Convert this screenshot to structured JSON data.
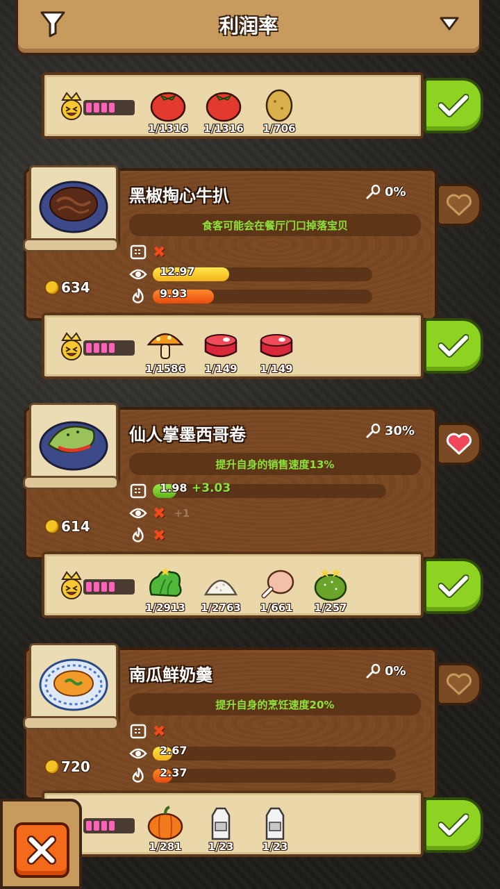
{
  "header": {
    "title": "利润率"
  },
  "top_strip": {
    "ingredients": [
      {
        "name": "tomato",
        "count": "1/1316"
      },
      {
        "name": "tomato",
        "count": "1/1316"
      },
      {
        "name": "potato",
        "count": "1/706"
      }
    ]
  },
  "dishes": [
    {
      "name": "黑椒掏心牛扒",
      "popularity": "0%",
      "effect": "食客可能会在餐厅门口掉落宝贝",
      "price": "634",
      "favorite": false,
      "stats": {
        "speed": {
          "text": "",
          "x": true
        },
        "appeal": {
          "value": "12.97",
          "fill": 0.3
        },
        "cook": {
          "value": "9.93",
          "fill": 0.24
        }
      },
      "ingredients": [
        {
          "name": "mushroom",
          "count": "1/1586"
        },
        {
          "name": "steak",
          "count": "1/149"
        },
        {
          "name": "steak",
          "count": "1/149"
        }
      ]
    },
    {
      "name": "仙人掌墨西哥卷",
      "popularity": "30%",
      "effect": "提升自身的销售速度13%",
      "price": "614",
      "favorite": true,
      "stats": {
        "speed": {
          "value": "1.98",
          "bonus": "+3.03",
          "fill": 0.1
        },
        "appeal": {
          "plus": "+1"
        },
        "cook": {}
      },
      "ingredients": [
        {
          "name": "lettuce",
          "count": "1/2913"
        },
        {
          "name": "rice",
          "count": "1/2763"
        },
        {
          "name": "chicken-leg",
          "count": "1/661"
        },
        {
          "name": "cactus",
          "count": "1/257"
        }
      ]
    },
    {
      "name": "南瓜鲜奶羹",
      "popularity": "0%",
      "effect": "提升自身的烹饪速度20%",
      "price": "720",
      "favorite": false,
      "stats": {
        "speed": {},
        "appeal": {
          "value": "2.67",
          "fill": 0.08
        },
        "cook": {
          "value": "2.37",
          "fill": 0.08
        }
      },
      "ingredients": [
        {
          "name": "pumpkin",
          "count": "1/281"
        },
        {
          "name": "milk-carton",
          "count": "1/23"
        },
        {
          "name": "milk-carton",
          "count": "1/23"
        }
      ]
    }
  ],
  "colors": {
    "wood": "#7a4a24",
    "parchment": "#ead7aa",
    "confirm_green": "#8ed321",
    "effect_text": "#8ce33c",
    "close_orange": "#f36a1a",
    "heart_red": "#f0485a"
  }
}
